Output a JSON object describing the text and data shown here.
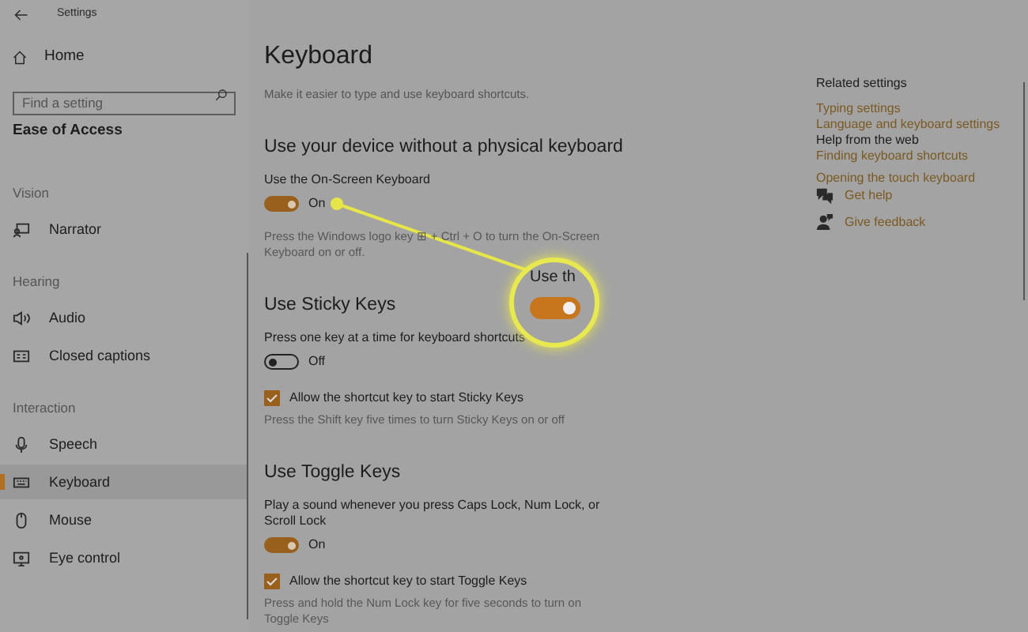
{
  "window": {
    "title": "Settings"
  },
  "sidebar": {
    "home": "Home",
    "search": {
      "placeholder": "Find a setting"
    },
    "category": "Ease of Access",
    "groups": [
      {
        "header": "Vision",
        "items": [
          {
            "label": "Narrator",
            "kind": "narrator",
            "selected": false
          }
        ]
      },
      {
        "header": "Hearing",
        "items": [
          {
            "label": "Audio",
            "kind": "audio",
            "selected": false
          },
          {
            "label": "Closed captions",
            "kind": "captions",
            "selected": false
          }
        ]
      },
      {
        "header": "Interaction",
        "items": [
          {
            "label": "Speech",
            "kind": "speech",
            "selected": false
          },
          {
            "label": "Keyboard",
            "kind": "keyboard",
            "selected": true
          },
          {
            "label": "Mouse",
            "kind": "mouse",
            "selected": false
          },
          {
            "label": "Eye control",
            "kind": "eye",
            "selected": false
          }
        ]
      }
    ]
  },
  "page": {
    "title": "Keyboard",
    "subtitle": "Make it easier to type and use keyboard shortcuts.",
    "sections": [
      {
        "heading": "Use your device without a physical keyboard",
        "rows": [
          {
            "kind": "label",
            "text": "Use the On-Screen Keyboard"
          },
          {
            "kind": "toggle",
            "on": true,
            "text": "On"
          },
          {
            "kind": "hint",
            "text": "Press the Windows logo key ⊞ + Ctrl + O to turn the On-Screen Keyboard on or off."
          }
        ]
      },
      {
        "heading": "Use Sticky Keys",
        "rows": [
          {
            "kind": "label",
            "text": "Press one key at a time for keyboard shortcuts"
          },
          {
            "kind": "toggle",
            "on": false,
            "text": "Off"
          },
          {
            "kind": "checkbox",
            "checked": true,
            "text": "Allow the shortcut key to start Sticky Keys"
          },
          {
            "kind": "hint",
            "text": "Press the Shift key five times to turn Sticky Keys on or off"
          }
        ]
      },
      {
        "heading": "Use Toggle Keys",
        "rows": [
          {
            "kind": "label",
            "text": "Play a sound whenever you press Caps Lock, Num Lock, or Scroll Lock"
          },
          {
            "kind": "toggle",
            "on": true,
            "text": "On"
          },
          {
            "kind": "checkbox",
            "checked": true,
            "text": "Allow the shortcut key to start Toggle Keys"
          },
          {
            "kind": "hint",
            "text": "Press and hold the Num Lock key for five seconds to turn on Toggle Keys"
          }
        ]
      }
    ]
  },
  "related": {
    "heading": "Related settings",
    "links": [
      "Typing settings",
      "Language and keyboard settings"
    ]
  },
  "help": {
    "heading": "Help from the web",
    "links": [
      "Finding keyboard shortcuts",
      "Opening the touch keyboard"
    ]
  },
  "actions": [
    {
      "label": "Get help",
      "kind": "help"
    },
    {
      "label": "Give feedback",
      "kind": "feedback"
    }
  ],
  "callout": {
    "text": "Use th",
    "on": true
  }
}
